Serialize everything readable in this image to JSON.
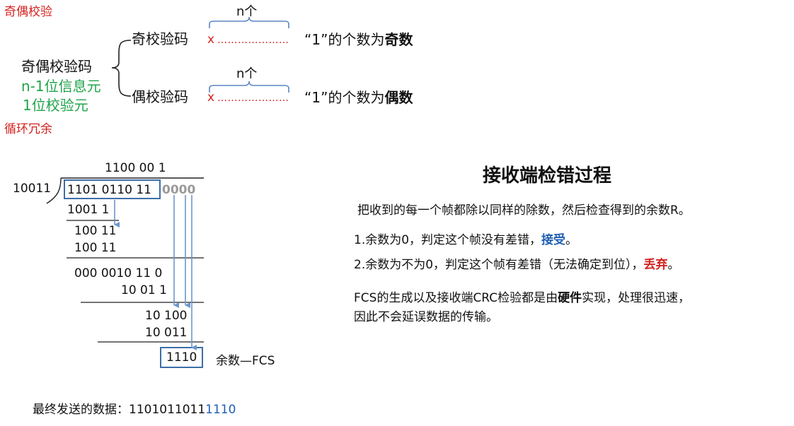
{
  "parity": {
    "section_title": "奇偶校验",
    "root_label": "奇偶校验码",
    "info_bits": "n-1位信息元",
    "check_bit": "1位校验元",
    "n_label_top": "n个",
    "n_label_bottom": "n个",
    "odd": {
      "label": "奇校验码",
      "x": "x",
      "dots": "…………………",
      "desc_prefix": "“1”的个数为",
      "desc_bold": "奇数"
    },
    "even": {
      "label": "偶校验码",
      "x": "x",
      "dots": "…………………",
      "desc_prefix": "“1”的个数为",
      "desc_bold": "偶数"
    }
  },
  "crc": {
    "section_title": "循环冗余",
    "divisor": "10011",
    "quotient": "1100 00 1",
    "dividend": "1101 0110 11",
    "appended_zeros": "0000",
    "steps": [
      "1001 1",
      "100 11",
      "100 11",
      "000 0010 11  0",
      "10 01 1",
      "10 100",
      "10 011"
    ],
    "remainder": "1110",
    "remainder_label": "余数—FCS",
    "final_prefix": "最终发送的数据：",
    "final_data": "1101011011",
    "final_fcs": "1110"
  },
  "receiver": {
    "title": "接收端检错过程",
    "intro": "把收到的每一个帧都除以同样的除数，然后检查得到的余数R。",
    "rule1_prefix": "1.余数为0，判定这个帧没有差错，",
    "rule1_action": "接受",
    "rule1_suffix": "。",
    "rule2_prefix": "2.余数为不为0，判定这个帧有差错（无法确定到位），",
    "rule2_action": "丢弃",
    "rule2_suffix": "。",
    "fcs_line1_prefix": "FCS的生成以及接收端CRC检验都是由",
    "fcs_line1_bold": "硬件",
    "fcs_line1_suffix": "实现，处理很迅速，",
    "fcs_line2": "因此不会延误数据的传输。"
  },
  "colors": {
    "red": "#d4221f",
    "green": "#1fa34a",
    "blue": "#1f5fb4",
    "box": "#3d6ea8",
    "arrow": "#6c96cc"
  }
}
